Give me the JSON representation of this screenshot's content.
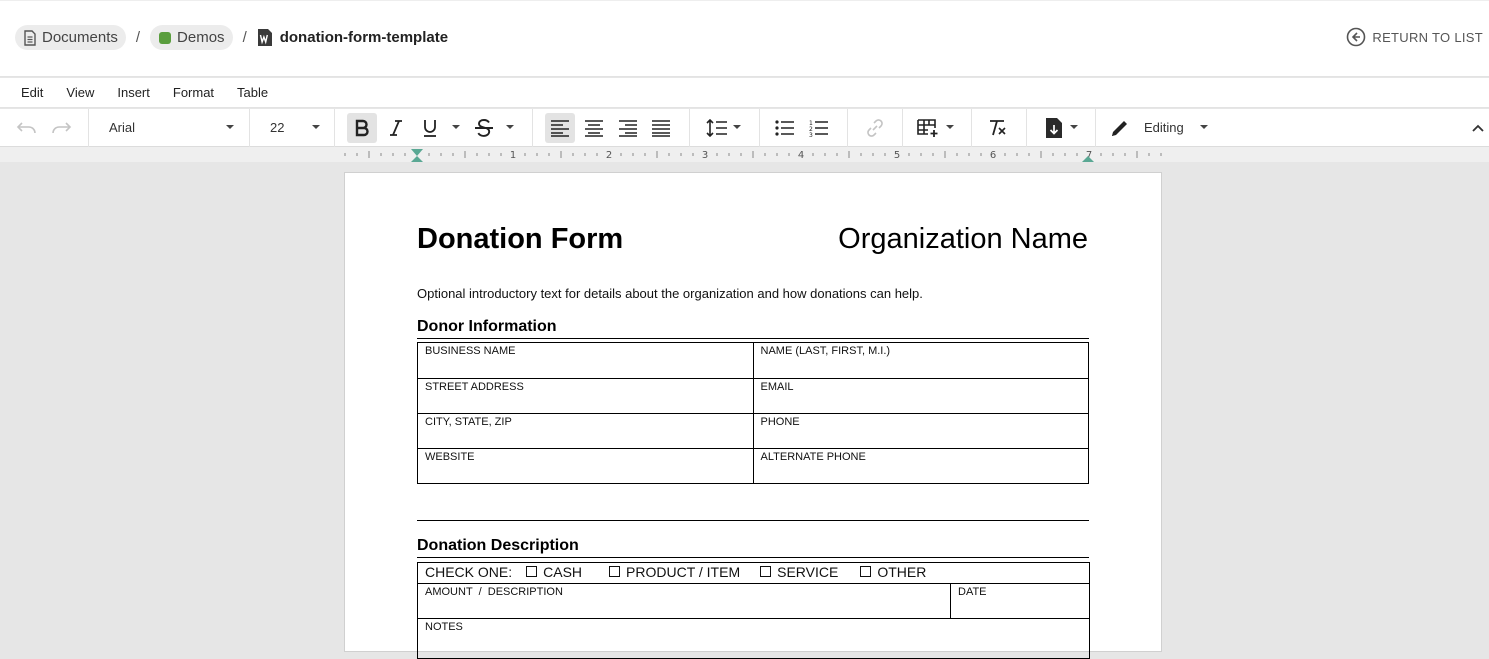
{
  "breadcrumb": {
    "root": "Documents",
    "folder": "Demos",
    "folder_color": "#5a9e3e",
    "separator": "/",
    "document": "donation-form-template"
  },
  "header": {
    "return_label": "RETURN TO LIST"
  },
  "menu": {
    "edit": "Edit",
    "view": "View",
    "insert": "Insert",
    "format": "Format",
    "table": "Table"
  },
  "toolbar": {
    "font_family": "Arial",
    "font_size": "22",
    "mode": "Editing"
  },
  "ruler": {
    "numbers": [
      "1",
      "2",
      "3",
      "4",
      "5",
      "6",
      "7"
    ]
  },
  "document": {
    "title": "Donation Form",
    "org_name": "Organization Name",
    "intro": "Optional introductory text for details about the organization and how donations can help.",
    "donor_heading": "Donor Information",
    "donor_fields": {
      "business_name": "BUSINESS NAME",
      "name": "NAME (LAST, FIRST, M.I.)",
      "street_address": "STREET ADDRESS",
      "email": "EMAIL",
      "city_state_zip": "CITY, STATE, ZIP",
      "phone": "PHONE",
      "website": "WEBSITE",
      "alternate_phone": "ALTERNATE PHONE"
    },
    "description_heading": "Donation Description",
    "check_one": "CHECK ONE:",
    "options": {
      "cash": "CASH",
      "product": "PRODUCT / ITEM",
      "service": "SERVICE",
      "other": "OTHER"
    },
    "amount_description": "AMOUNT  /  DESCRIPTION",
    "date": "DATE",
    "notes": "NOTES"
  }
}
